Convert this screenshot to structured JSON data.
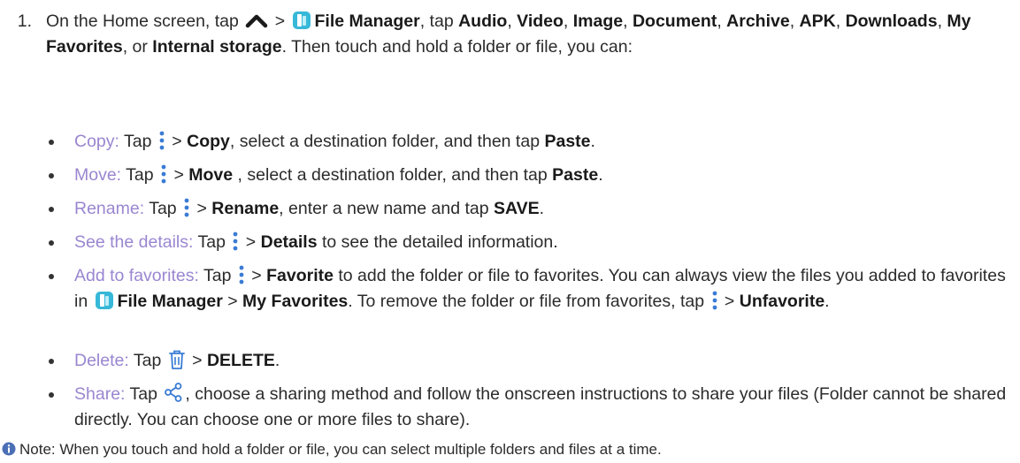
{
  "step": {
    "number": "1.",
    "line_parts": [
      "On the Home screen, tap ",
      " > ",
      "File Manager",
      ", tap ",
      "Audio",
      ", ",
      "Video",
      ", ",
      "Image",
      ", ",
      "Document",
      ", ",
      "Archive",
      ", ",
      "APK",
      ", ",
      "Downloads",
      ", ",
      "My Favorites",
      ", or ",
      "Internal storage",
      ". Then touch and hold a folder or file, you can:"
    ]
  },
  "items": [
    {
      "term": "Copy:",
      "parts": [
        " Tap ",
        " > ",
        "Copy",
        ", select a destination folder, and then tap ",
        "Paste",
        "."
      ]
    },
    {
      "term": "Move:",
      "parts": [
        " Tap ",
        " > ",
        "Move",
        " , select a destination folder, and then tap ",
        "Paste",
        "."
      ]
    },
    {
      "term": "Rename:",
      "parts": [
        " Tap ",
        " > ",
        "Rename",
        ", enter a new name and tap ",
        "SAVE",
        "."
      ]
    },
    {
      "term": "See the details:",
      "parts": [
        " Tap ",
        " > ",
        "Details",
        " to see the detailed information."
      ]
    },
    {
      "term": "Add to favorites:",
      "parts": [
        " Tap ",
        " > ",
        "Favorite",
        " to add the folder or file to favorites. You can always view the files you added to favorites in ",
        "File Manager",
        " > ",
        "My Favorites",
        ". To remove the folder or file from favorites, tap ",
        " > ",
        "Unfavorite",
        "."
      ]
    },
    {
      "term": "Delete:",
      "parts": [
        " Tap ",
        " > ",
        "DELETE",
        "."
      ]
    },
    {
      "term": "Share:",
      "parts": [
        " Tap ",
        ", choose a sharing method and follow the onscreen instructions to share your files (Folder cannot be shared directly. You can choose one or more files to share)."
      ]
    }
  ],
  "note": {
    "text": "Note: When you touch and hold a folder or file, you can select multiple folders and files at a time."
  },
  "colors": {
    "text": "#2b2b2b",
    "term": "#9a86d0",
    "dots_icon": "#3a7bd5",
    "file_manager_icon": "#37b8d8",
    "info_icon": "#4a6fb5"
  },
  "icons": {
    "up": "caret-up-icon",
    "app": "file-manager-icon",
    "menu": "more-vertical-icon",
    "delete": "trash-icon",
    "share": "share-icon",
    "note": "info-icon"
  }
}
